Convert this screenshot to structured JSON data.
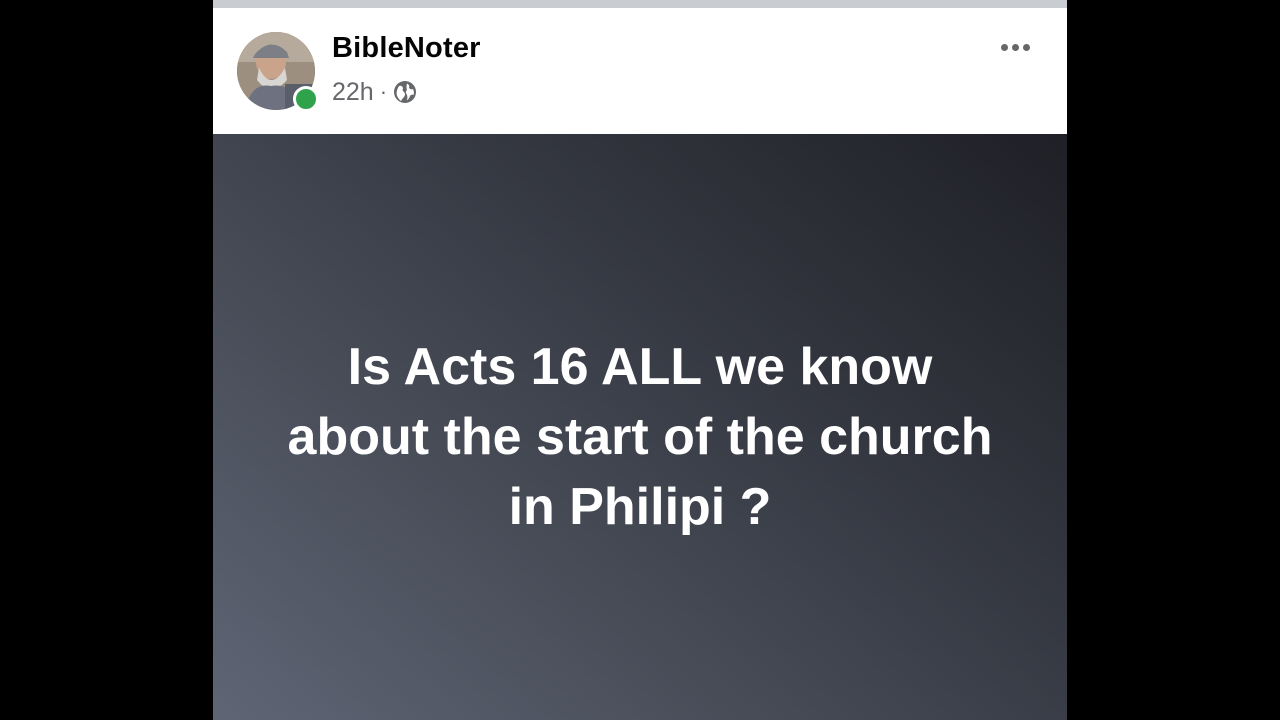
{
  "post": {
    "author": {
      "name": "BibleNoter",
      "avatar_icon": "profile-photo",
      "online_status_color": "#31a24c"
    },
    "meta": {
      "time": "22h",
      "separator": "·",
      "audience_icon": "globe-icon"
    },
    "more_options_icon": "more-horizontal-icon",
    "body": {
      "lines": [
        "Is Acts 16 ALL we know",
        "about the start of the church",
        "in Philipi ?"
      ],
      "background_gradient": [
        "#5f6575",
        "#1f2026"
      ],
      "text_color": "#ffffff"
    }
  }
}
